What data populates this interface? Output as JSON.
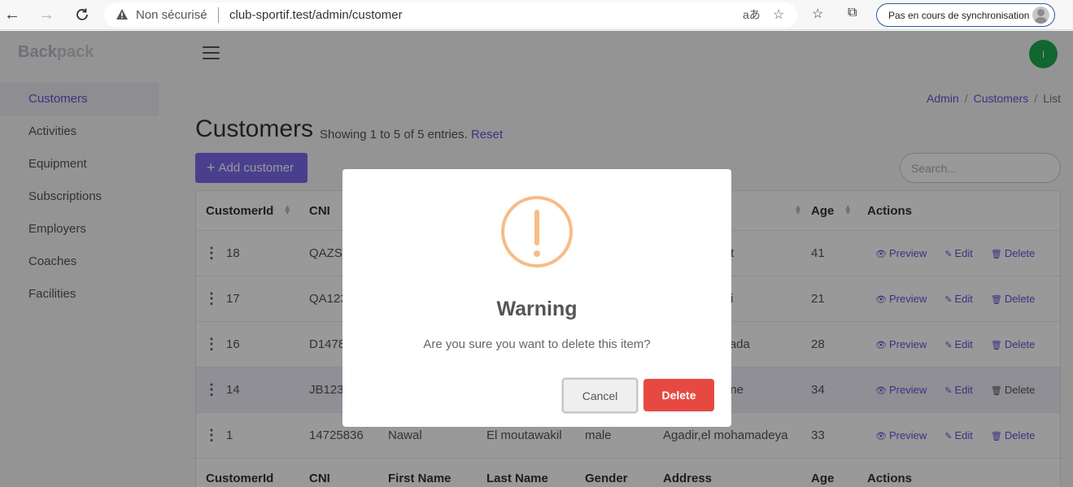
{
  "browser": {
    "not_secure_label": "Non sécurisé",
    "url": "club-sportif.test/admin/customer",
    "sync_label": "Pas en cours de synchronisation"
  },
  "app": {
    "brand_first": "Back",
    "brand_second": "pack",
    "user_initial": "I"
  },
  "sidebar": {
    "items": [
      {
        "label": "Customers"
      },
      {
        "label": "Activities"
      },
      {
        "label": "Equipment"
      },
      {
        "label": "Subscriptions"
      },
      {
        "label": "Employers"
      },
      {
        "label": "Coaches"
      },
      {
        "label": "Facilities"
      }
    ]
  },
  "breadcrumb": {
    "admin": "Admin",
    "customers": "Customers",
    "current": "List",
    "sep": "/"
  },
  "page": {
    "title": "Customers",
    "entries_text": "Showing 1 to 5 of 5 entries.",
    "reset_label": "Reset",
    "add_button_label": "Add customer",
    "search_placeholder": "Search..."
  },
  "table": {
    "headers": {
      "id": "CustomerId",
      "cni": "CNI",
      "first_name": "First Name",
      "last_name": "Last Name",
      "gender": "Gender",
      "address": "Address",
      "age": "Age",
      "actions": "Actions"
    },
    "rows": [
      {
        "id": "18",
        "cni": "QAZSE",
        "address_tail": "t",
        "age": "41"
      },
      {
        "id": "17",
        "cni": "QA123",
        "address_tail": "i",
        "age": "21"
      },
      {
        "id": "16",
        "cni": "D1478",
        "address_tail": "akada",
        "age": "28"
      },
      {
        "id": "14",
        "cni": "JB123",
        "address_tail": "ane",
        "age": "34"
      },
      {
        "id": "1",
        "cni": "14725836",
        "first_name": "Nawal",
        "last_name": "El moutawakil",
        "gender": "male",
        "address": "Agadir,el mohamadeya",
        "age": "33"
      }
    ],
    "actions": {
      "preview": "Preview",
      "edit": "Edit",
      "delete": "Delete"
    }
  },
  "modal": {
    "title": "Warning",
    "text": "Are you sure you want to delete this item?",
    "cancel_label": "Cancel",
    "delete_label": "Delete"
  },
  "colors": {
    "accent": "#7c69ef",
    "link": "#6a52d6",
    "danger": "#e64942",
    "warning": "#f8bb86",
    "avatar": "#1eab4f"
  }
}
